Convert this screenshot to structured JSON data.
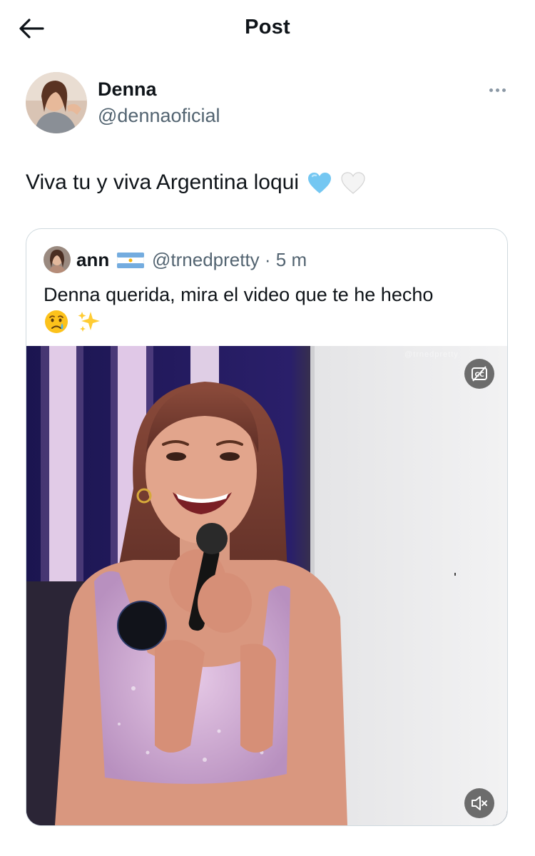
{
  "header": {
    "title": "Post",
    "back_icon": "arrow-left-icon"
  },
  "author": {
    "name": "Denna",
    "handle": "@dennaoficial",
    "more_icon": "more-horizontal-icon"
  },
  "tweet": {
    "text": "Viva tu y viva Argentina loqui",
    "emojis": [
      "light-blue-heart-icon",
      "white-heart-icon"
    ]
  },
  "quote": {
    "name": "ann",
    "flag_icon": "argentina-flag-icon",
    "handle_time": "@trnedpretty · 5 m",
    "text": "Denna querida, mira el video que te he hecho",
    "emojis": [
      "crying-face-icon",
      "sparkles-icon"
    ]
  },
  "video": {
    "captions_icon": "closed-captions-off-icon",
    "mute_icon": "speaker-muted-icon",
    "watermark": "@trnedpretty"
  },
  "colors": {
    "text_primary": "#0f1419",
    "text_secondary": "#536471",
    "border": "#cfd9de",
    "heart_blue": "#74c7f2",
    "flag_blue": "#74acdf"
  }
}
